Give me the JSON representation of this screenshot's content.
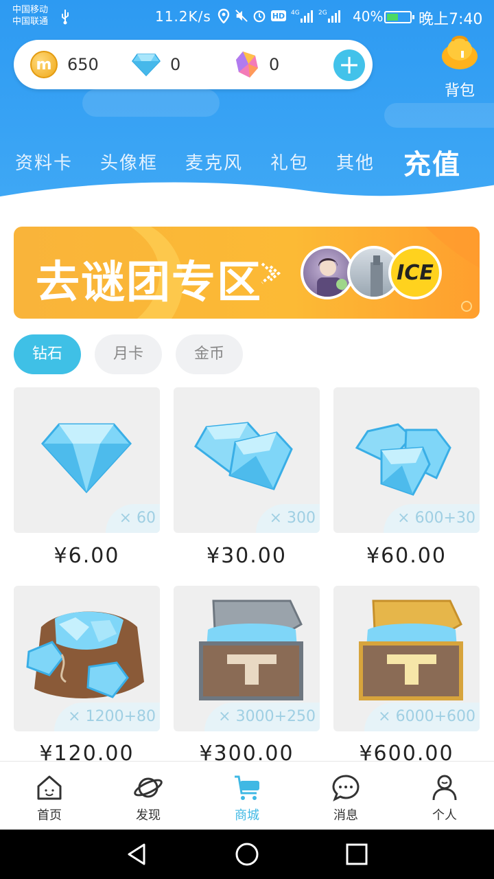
{
  "status_bar": {
    "carrier1": "中国移动",
    "carrier2": "中国联通",
    "net_speed": "11.2K/s",
    "battery": "40%",
    "time": "晚上7:40",
    "icons": [
      "usb-icon",
      "location-icon",
      "mute-icon",
      "alarm-icon",
      "hd-icon",
      "signal-4g-icon",
      "signal-2g-icon"
    ]
  },
  "wallet": {
    "coins": "650",
    "diamonds": "0",
    "crystals": "0",
    "coin_symbol": "m"
  },
  "backpack": {
    "label": "背包"
  },
  "categories": [
    {
      "label": "资料卡"
    },
    {
      "label": "头像框"
    },
    {
      "label": "麦克风"
    },
    {
      "label": "礼包"
    },
    {
      "label": "其他"
    },
    {
      "label": "充值"
    }
  ],
  "banner": {
    "title": "去谜团专区",
    "badge_text": "ICE"
  },
  "sub_tabs": [
    {
      "label": "钻石"
    },
    {
      "label": "月卡"
    },
    {
      "label": "金币"
    }
  ],
  "products": [
    {
      "qty": "× 60",
      "price": "¥6.00",
      "icon": "single-diamond"
    },
    {
      "qty": "× 300",
      "price": "¥30.00",
      "icon": "two-diamonds"
    },
    {
      "qty": "× 600+30",
      "price": "¥60.00",
      "icon": "three-diamonds"
    },
    {
      "qty": "× 1200+80",
      "price": "¥120.00",
      "icon": "diamond-bag"
    },
    {
      "qty": "× 3000+250",
      "price": "¥300.00",
      "icon": "silver-chest"
    },
    {
      "qty": "× 6000+600",
      "price": "¥600.00",
      "icon": "gold-chest"
    }
  ],
  "bottom_nav": [
    {
      "label": "首页",
      "icon": "home-icon"
    },
    {
      "label": "发现",
      "icon": "planet-icon"
    },
    {
      "label": "商城",
      "icon": "cart-icon",
      "active": true
    },
    {
      "label": "消息",
      "icon": "chat-icon"
    },
    {
      "label": "个人",
      "icon": "person-icon"
    }
  ],
  "colors": {
    "header_blue": "#2d9af2",
    "accent_cyan": "#3fc0e6",
    "banner_orange": "#fcba35"
  }
}
